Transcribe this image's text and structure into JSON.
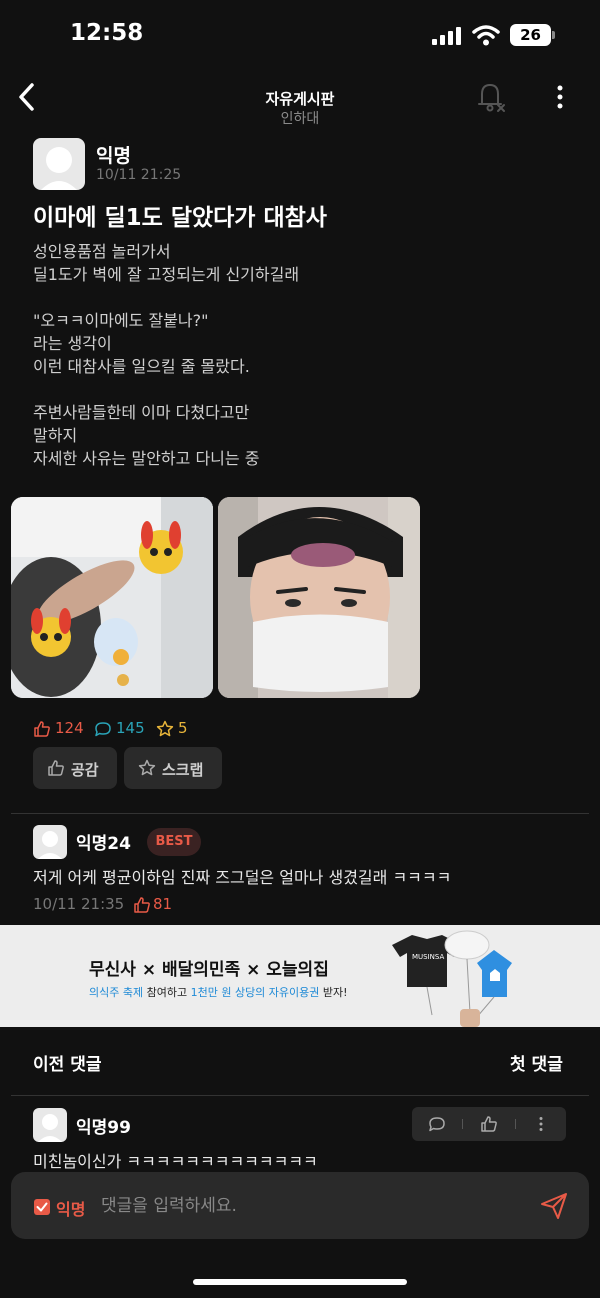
{
  "status_bar": {
    "time": "12:58",
    "battery": "26"
  },
  "nav": {
    "title": "자유게시판",
    "subtitle": "인하대"
  },
  "post": {
    "author": "익명",
    "timestamp": "10/11 21:25",
    "title": "이마에 딜1도 달았다가 대참사",
    "body_lines": [
      "성인용품점 놀러가서",
      "딜1도가 벽에 잘 고정되는게 신기하길래",
      "",
      "\"오ㅋㅋ이마에도 잘붙나?\"",
      "라는 생각이",
      "이런 대참사를 일으킬 줄 몰랐다.",
      "",
      "주변사람들한테 이마 다쳤다고만",
      "말하지",
      "자세한 사유는 말안하고 다니는 중"
    ],
    "stats": {
      "likes": "124",
      "comments": "145",
      "scraps": "5"
    },
    "actions": {
      "like_label": "공감",
      "scrap_label": "스크랩"
    }
  },
  "best_comment": {
    "author": "익명24",
    "badge": "BEST",
    "text": "저게 어케 평균이하임 진짜 즈그덜은 얼마나 생겼길래 ㅋㅋㅋㅋ",
    "timestamp": "10/11 21:35",
    "likes": "81"
  },
  "ad": {
    "title": "무신사 × 배달의민족 × 오늘의집",
    "sub_1": "의식주 축제",
    "sub_2": " 참여하고 ",
    "sub_3": "1천만 원 상당의 자유이용권",
    "sub_4": " 받자!",
    "art_label": "MUSINSA"
  },
  "comment_nav": {
    "prev": "이전 댓글",
    "first": "첫 댓글"
  },
  "comment": {
    "author": "익명99",
    "text": "미친놈이신가 ㅋㅋㅋㅋㅋㅋㅋㅋㅋㅋㅋㅋㅋ"
  },
  "input_bar": {
    "anon_label": "익명",
    "placeholder": "댓글을 입력하세요."
  },
  "colors": {
    "accent": "#e85a47",
    "comment_blue": "#2aa4b8",
    "scrap_yellow": "#e8b53a"
  },
  "icons": [
    "back-icon",
    "bell-off-icon",
    "more-vertical-icon",
    "thumbs-up-icon",
    "speech-bubble-icon",
    "star-icon",
    "send-icon"
  ]
}
